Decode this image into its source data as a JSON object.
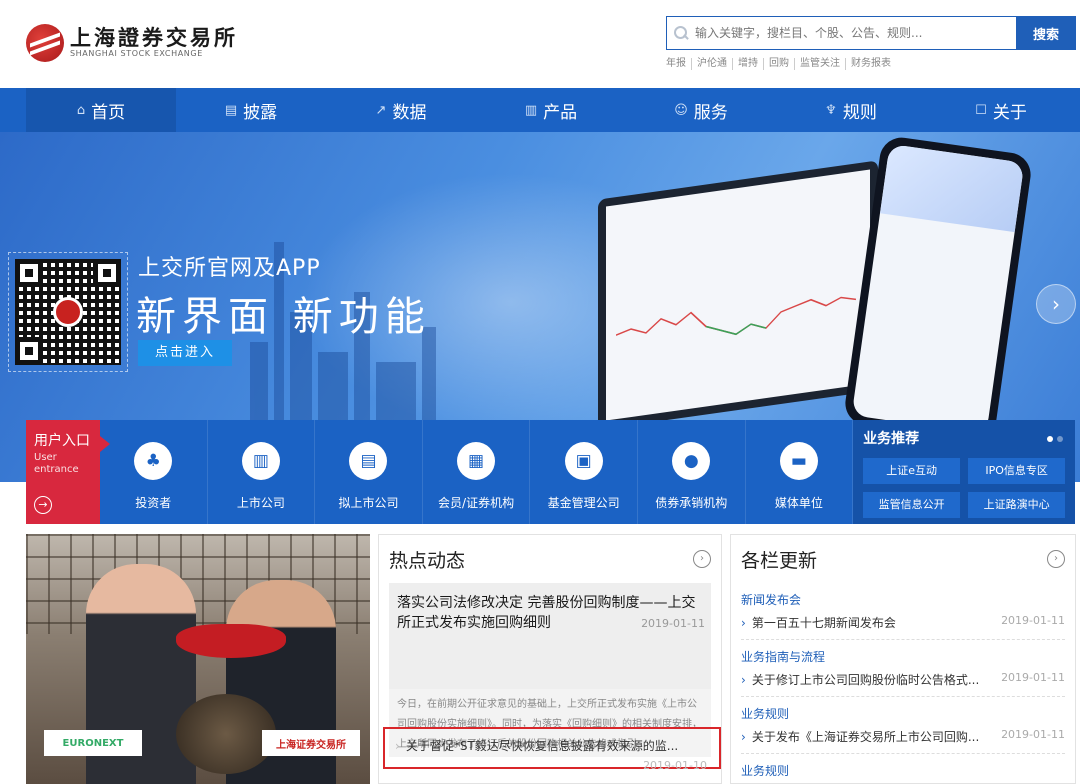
{
  "header": {
    "logo_cn": "上海證券交易所",
    "logo_en": "SHANGHAI STOCK EXCHANGE",
    "search_placeholder": "输入关键字，搜栏目、个股、公告、规则...",
    "search_button": "搜索",
    "quick_links": [
      "年报",
      "沪伦通",
      "增持",
      "回购",
      "监管关注",
      "财务报表"
    ]
  },
  "nav": {
    "items": [
      {
        "label": "首页",
        "icon": "home-icon"
      },
      {
        "label": "披露",
        "icon": "document-icon"
      },
      {
        "label": "数据",
        "icon": "chart-icon"
      },
      {
        "label": "产品",
        "icon": "product-icon"
      },
      {
        "label": "服务",
        "icon": "service-icon"
      },
      {
        "label": "规则",
        "icon": "rule-icon"
      },
      {
        "label": "关于",
        "icon": "about-icon"
      }
    ]
  },
  "banner": {
    "line1": "上交所官网及APP",
    "line2": "新界面 新功能",
    "cta": "点击进入"
  },
  "entry": {
    "user_cn": "用户入口",
    "user_en": "User entrance",
    "items": [
      "投资者",
      "上市公司",
      "拟上市公司",
      "会员/证券机构",
      "基金管理公司",
      "债券承销机构",
      "媒体单位"
    ],
    "recommend_title": "业务推荐",
    "recommend_links": [
      "上证e互动",
      "IPO信息专区",
      "监管信息公开",
      "上证路演中心"
    ]
  },
  "photo": {
    "sign_left": "EURONEXT",
    "sign_right": "上海证券交易所"
  },
  "hot": {
    "title": "热点动态",
    "featured_title": "落实公司法修改决定 完善股份回购制度——上交所正式发布实施回购细则",
    "featured_date": "2019-01-11",
    "featured_desc": "今日，在前期公开征求意见的基础上，上交所正式发布实施《上市公司回购股份实施细则》。同时，为落实《回购细则》的相关制度安排，上交所同步发布了修订后的股份回购相关公告格式指引...",
    "item_title": "关于督促*ST毅达尽快恢复信息披露有效来源的监...",
    "item_date": "2019-01-10"
  },
  "columns": {
    "title": "各栏更新",
    "groups": [
      {
        "category": "新闻发布会",
        "text": "第一百五十七期新闻发布会",
        "date": "2019-01-11"
      },
      {
        "category": "业务指南与流程",
        "text": "关于修订上市公司回购股份临时公告格式...",
        "date": "2019-01-11"
      },
      {
        "category": "业务规则",
        "text": "关于发布《上海证券交易所上市公司回购...",
        "date": "2019-01-11"
      },
      {
        "category": "业务规则",
        "text": "",
        "date": ""
      }
    ]
  }
}
